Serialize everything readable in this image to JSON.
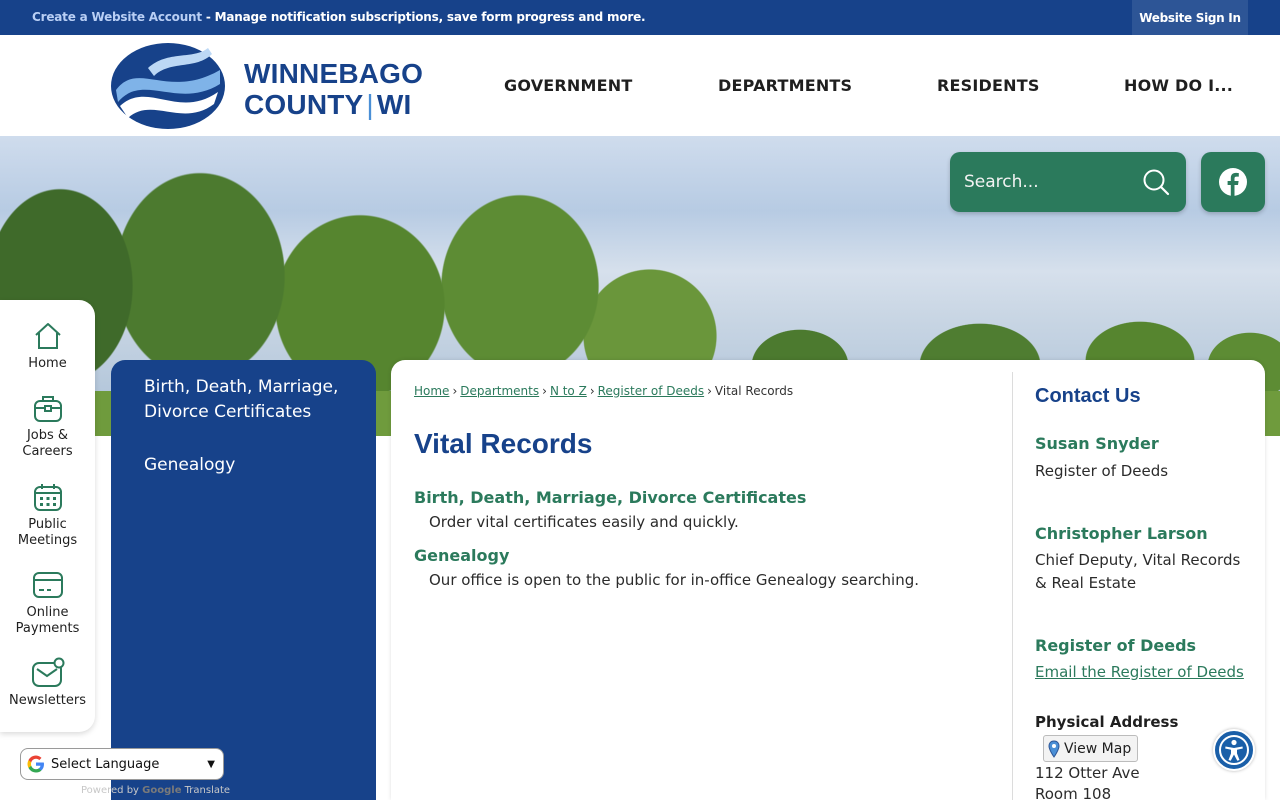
{
  "topbar": {
    "create_account_link": "Create a Website Account",
    "create_account_text": " - Manage notification subscriptions, save form progress and more.",
    "sign_in": "Website Sign In"
  },
  "brand": {
    "line1": "WINNEBAGO",
    "line2": "COUNTY",
    "separator": "|",
    "state": "WI"
  },
  "nav": [
    "GOVERNMENT",
    "DEPARTMENTS",
    "RESIDENTS",
    "HOW DO I..."
  ],
  "search": {
    "placeholder": "Search..."
  },
  "quick_links": [
    {
      "label": "Home",
      "icon": "home-icon"
    },
    {
      "label": "Jobs & Careers",
      "icon": "briefcase-icon"
    },
    {
      "label": "Public Meetings",
      "icon": "calendar-icon"
    },
    {
      "label": "Online Payments",
      "icon": "credit-card-icon"
    },
    {
      "label": "Newsletters",
      "icon": "newsletter-icon"
    }
  ],
  "quick_links_lines": {
    "jobs_1": "Jobs &",
    "jobs_2": "Careers",
    "meetings_1": "Public",
    "meetings_2": "Meetings",
    "payments_1": "Online",
    "payments_2": "Payments"
  },
  "sidenav": {
    "items": [
      "Birth, Death, Marriage, Divorce Certificates",
      "Genealogy"
    ]
  },
  "breadcrumb": {
    "items": [
      "Home",
      "Departments",
      "N to Z",
      "Register of Deeds"
    ],
    "current": "Vital Records",
    "separator": "›"
  },
  "page": {
    "title": "Vital Records",
    "entries": [
      {
        "title": "Birth, Death, Marriage, Divorce Certificates",
        "desc": "Order vital certificates easily and quickly."
      },
      {
        "title": "Genealogy",
        "desc": "Our office is open to the public for in-office Genealogy searching."
      }
    ]
  },
  "contact": {
    "heading": "Contact Us",
    "people": [
      {
        "name": "Susan Snyder",
        "role": "Register of Deeds"
      },
      {
        "name": "Christopher Larson",
        "role": "Chief Deputy, Vital Records & Real Estate"
      }
    ],
    "office": "Register of Deeds",
    "email_link": "Email the Register of Deeds",
    "address_heading": "Physical Address",
    "view_map": "View Map",
    "address_lines": [
      "112 Otter Ave",
      "Room 108"
    ]
  },
  "language": {
    "selected": "Select Language",
    "powered_by": "Powered by",
    "google": "Google",
    "translate": "Translate"
  },
  "colors": {
    "brand_blue": "#17428a",
    "brand_green": "#2b7a5c",
    "accessibility_blue": "#1a5fa8"
  }
}
